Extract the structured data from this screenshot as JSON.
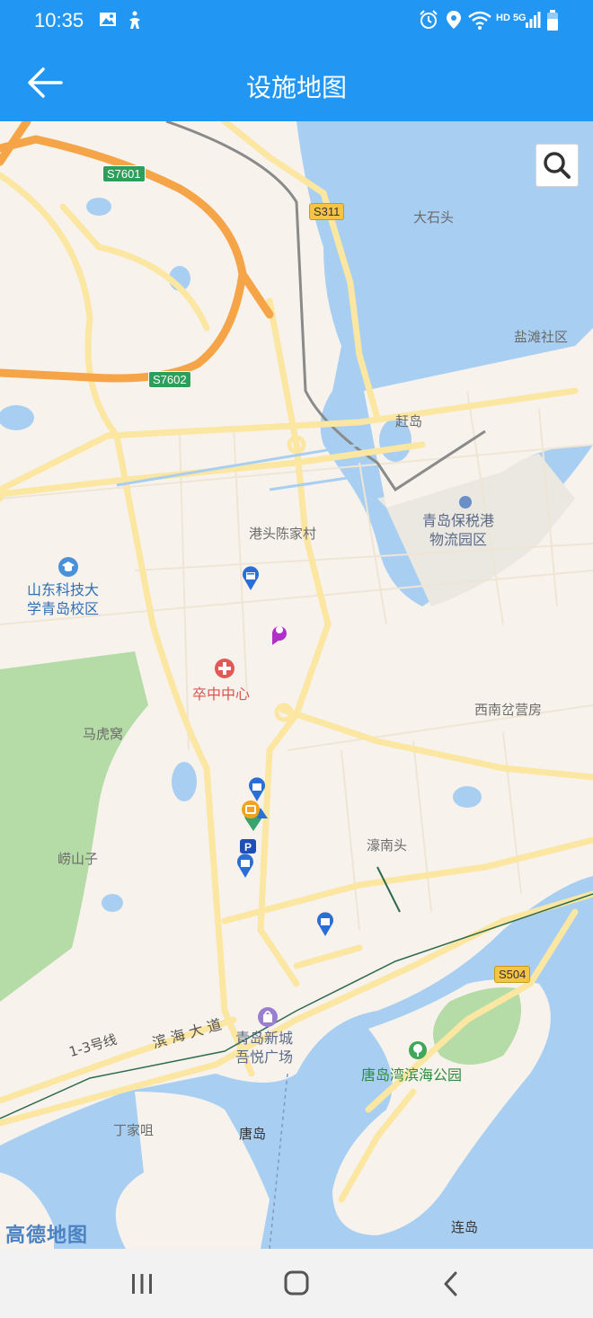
{
  "status_bar": {
    "time": "10:35",
    "icons": [
      "image-icon",
      "accessibility-icon",
      "alarm-icon",
      "location-icon",
      "wifi-icon",
      "hd-icon",
      "signal-5g-icon",
      "battery-icon"
    ],
    "network": "HD 5G"
  },
  "app_bar": {
    "title": "设施地图",
    "back_icon": "arrow-left-icon"
  },
  "map": {
    "search_icon": "search-icon",
    "road_badges": {
      "s7601": "S7601",
      "s7602": "S7602",
      "s311": "S311",
      "s504": "S504"
    },
    "labels": {
      "dashitou": "大石头",
      "yantan": "盐滩社区",
      "ganduo": "赶岛",
      "baoshui": "青岛保税港\n物流园区",
      "gangtou": "港头陈家村",
      "shandong": "山东科技大\n学青岛校区",
      "zuzhong": "卒中中心",
      "xinan": "西南岔营房",
      "mahuwo": "马虎窝",
      "haonan": "濠南头",
      "laoshanzi": "崂山子",
      "xincheng": "青岛新城\n吾悦广场",
      "binhaidadao": "滨 海 大 道",
      "line13": "1-3号线",
      "tangdao_park": "唐岛湾滨海公园",
      "dingjia": "丁家咀",
      "tangdao": "唐岛",
      "liandao": "连岛"
    },
    "logo": "高德地图",
    "colors": {
      "land": "#f7f3ec",
      "water": "#a8cff1",
      "park": "#b5dba6",
      "highway": "#f5a548",
      "road": "#fbe6a2",
      "header": "#2196f3"
    }
  },
  "nav_bar": {
    "recent_icon": "recent-apps-icon",
    "home_icon": "home-icon",
    "back_icon": "back-chevron-icon"
  }
}
